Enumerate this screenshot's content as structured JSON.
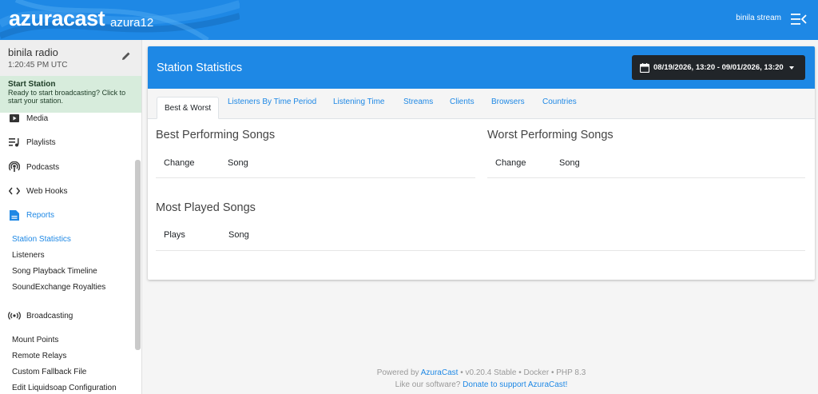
{
  "navbar": {
    "brand": "azuracast",
    "instance": "azura12",
    "user": "binila stream"
  },
  "sidebar": {
    "station_name": "binila radio",
    "station_time": "1:20:45 PM UTC",
    "start_title": "Start Station",
    "start_desc": "Ready to start broadcasting? Click to start your station.",
    "items": [
      {
        "label": "Media"
      },
      {
        "label": "Playlists"
      },
      {
        "label": "Podcasts"
      },
      {
        "label": "Web Hooks"
      },
      {
        "label": "Reports"
      },
      {
        "label": "Broadcasting"
      }
    ],
    "reports_sub": [
      "Station Statistics",
      "Listeners",
      "Song Playback Timeline",
      "SoundExchange Royalties"
    ],
    "broadcasting_sub": [
      "Mount Points",
      "Remote Relays",
      "Custom Fallback File",
      "Edit Liquidsoap Configuration"
    ]
  },
  "card": {
    "title": "Station Statistics",
    "date_range": "08/19/2026, 13:20 - 09/01/2026, 13:20",
    "tabs": [
      "Best & Worst",
      "Listeners By Time Period",
      "Listening Time",
      "Streams",
      "Clients",
      "Browsers",
      "Countries"
    ],
    "best_title": "Best Performing Songs",
    "worst_title": "Worst Performing Songs",
    "most_title": "Most Played Songs",
    "col_change": "Change",
    "col_song": "Song",
    "col_plays": "Plays"
  },
  "footer": {
    "powered_prefix": "Powered by",
    "powered_link": "AzuraCast",
    "powered_suffix": "• v0.20.4 Stable • Docker • PHP 8.3",
    "like_prefix": "Like our software?",
    "donate_link": "Donate to support AzuraCast!"
  },
  "colors": {
    "primary": "#1e88e5",
    "dark": "#212529",
    "success_bg": "#d7ecdc"
  }
}
